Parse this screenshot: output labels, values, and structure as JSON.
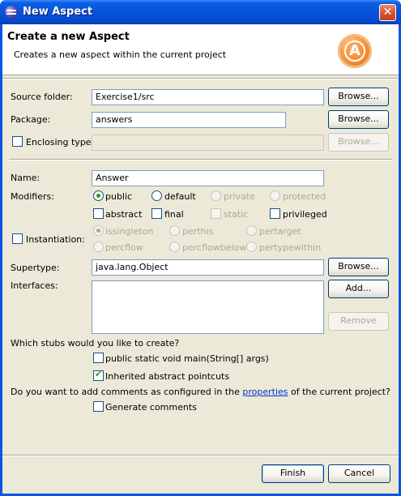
{
  "window": {
    "title": "New Aspect",
    "close_glyph": "✕"
  },
  "banner": {
    "title": "Create a new Aspect",
    "description": "Creates a new aspect within the current project",
    "logo_letter": "A"
  },
  "source": {
    "label": "Source folder:",
    "value": "Exercise1/src",
    "browse_label": "Browse..."
  },
  "package": {
    "label": "Package:",
    "value": "answers",
    "browse_label": "Browse..."
  },
  "enclosing": {
    "label": "Enclosing type:",
    "value": "",
    "checked": false,
    "browse_label": "Browse..."
  },
  "name": {
    "label": "Name:",
    "value": "Answer"
  },
  "modifiers": {
    "label": "Modifiers:",
    "access": [
      "public",
      "default",
      "private",
      "protected"
    ],
    "access_selected": "public",
    "flags": [
      "abstract",
      "final",
      "static",
      "privileged"
    ]
  },
  "instantiation": {
    "label": "Instantiation:",
    "checked": false,
    "options": [
      "issingleton",
      "perthis",
      "pertarget",
      "percflow",
      "percflowbelow",
      "pertypewithin"
    ],
    "selected": "issingleton"
  },
  "supertype": {
    "label": "Supertype:",
    "value": "java.lang.Object",
    "browse_label": "Browse..."
  },
  "interfaces": {
    "label": "Interfaces:",
    "add_label": "Add...",
    "remove_label": "Remove"
  },
  "stubs": {
    "question": "Which stubs would you like to create?",
    "main_label": "public static void main(String[] args)",
    "main_checked": false,
    "pointcuts_label": "Inherited abstract pointcuts",
    "pointcuts_checked": true
  },
  "comments": {
    "question_prefix": "Do you want to add comments as configured in the",
    "question_link": "properties",
    "question_suffix": "of the current project?",
    "generate_label": "Generate comments",
    "generate_checked": false
  },
  "footer": {
    "finish_label": "Finish",
    "cancel_label": "Cancel"
  }
}
